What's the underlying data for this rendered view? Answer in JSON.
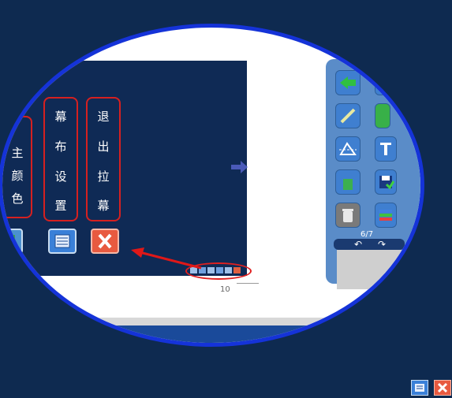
{
  "curtain_menu": {
    "column1": [
      "主",
      "颜",
      "色"
    ],
    "column2": [
      "幕",
      "布",
      "设",
      "置"
    ],
    "column3": [
      "退",
      "出",
      "拉",
      "幕"
    ]
  },
  "toolbar": {
    "page_counter": "6/7"
  },
  "page_number": "10",
  "icons": {
    "arrow_right": "right-arrow-icon",
    "close": "close-icon",
    "list": "list-icon"
  }
}
